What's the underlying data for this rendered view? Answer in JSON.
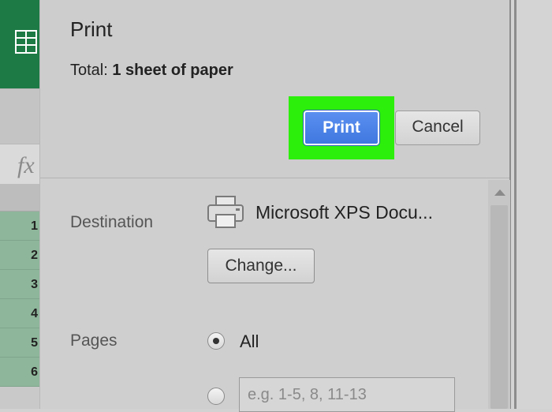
{
  "background_app": {
    "formula_label": "fx",
    "row_numbers": [
      "1",
      "2",
      "3",
      "4",
      "5",
      "6"
    ],
    "ribbon_color": "#1d7a44"
  },
  "dialog": {
    "title": "Print",
    "total_prefix": "Total:",
    "total_value": "1 sheet of paper",
    "print_button": "Print",
    "cancel_button": "Cancel",
    "highlight_color": "#2cf00c",
    "destination": {
      "label": "Destination",
      "printer_name": "Microsoft XPS Docu...",
      "change_button": "Change...",
      "icon": "printer-icon"
    },
    "pages": {
      "label": "Pages",
      "option_all": "All",
      "selected": "All",
      "custom_placeholder": "e.g. 1-5, 8, 11-13"
    }
  }
}
